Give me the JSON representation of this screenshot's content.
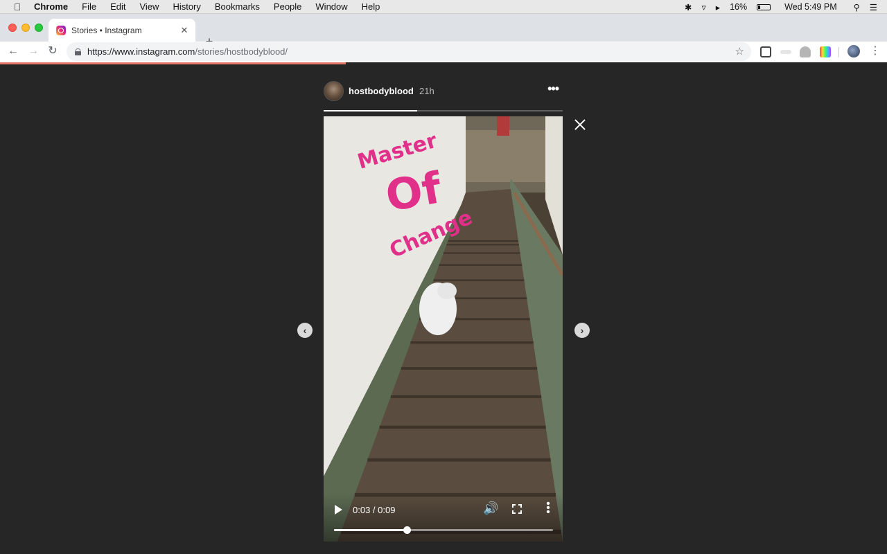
{
  "menubar": {
    "app": "Chrome",
    "items": [
      "File",
      "Edit",
      "View",
      "History",
      "Bookmarks",
      "People",
      "Window",
      "Help"
    ],
    "battery": "16%",
    "clock": "Wed 5:49 PM"
  },
  "tab": {
    "title": "Stories • Instagram"
  },
  "address": {
    "host": "https://www.instagram.com",
    "path": "/stories/hostbodyblood/"
  },
  "page_load_progress": 0.39,
  "story": {
    "username": "hostbodyblood",
    "posted": "21h",
    "story_progress": 0.39,
    "captions": [
      "Master",
      "Of",
      "Change"
    ],
    "caption_color": "#e0308a"
  },
  "video": {
    "time_display": "0:03 / 0:09",
    "current_seconds": 3,
    "duration_seconds": 9
  },
  "colors": {
    "background": "#262626",
    "load_bar": "#e8766a",
    "accent": "#ffffff"
  }
}
